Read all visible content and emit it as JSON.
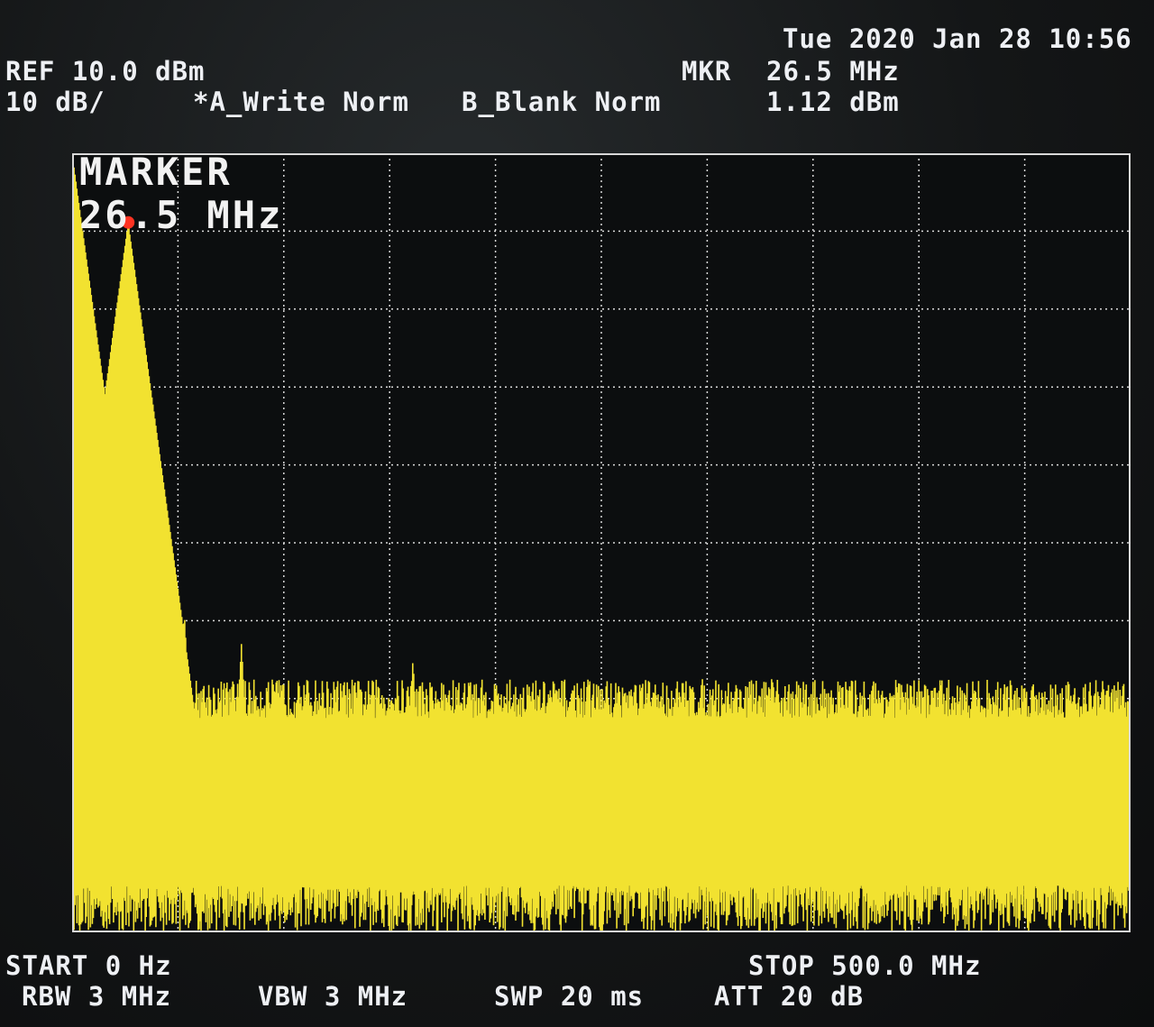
{
  "datetime": "Tue 2020 Jan 28 10:56",
  "ref_label": "REF 10.0 dBm",
  "scale_label": "10 dB/",
  "trace_a": "*A_Write Norm",
  "trace_b": "B_Blank Norm",
  "mkr_label": "MKR",
  "mkr_freq": "26.5 MHz",
  "mkr_level": "1.12 dBm",
  "marker_title": "MARKER",
  "marker_freq": "26.5 MHz",
  "start_label": "START 0 Hz",
  "stop_label": "STOP 500.0 MHz",
  "rbw_label": "RBW 3 MHz",
  "vbw_label": "VBW 3 MHz",
  "swp_label": "SWP 20 ms",
  "att_label": "ATT 20 dB",
  "colors": {
    "trace": "#f2e230",
    "marker": "#ff3322",
    "grid": "#d8d8d8",
    "text": "#eef0f4"
  },
  "chart_data": {
    "type": "line",
    "x_unit": "MHz",
    "y_unit": "dBm",
    "xlim": [
      0,
      500
    ],
    "ylim": [
      -90,
      10
    ],
    "divisions_x": 10,
    "divisions_y": 10,
    "grid": true,
    "marker": {
      "x": 26.5,
      "y": 1.12
    },
    "noise_floor": [
      -60,
      -90
    ],
    "peaks": [
      {
        "x": 0,
        "y": 10
      },
      {
        "x": 26.5,
        "y": 1.12
      },
      {
        "x": 53,
        "y": -49
      },
      {
        "x": 80,
        "y": -53
      },
      {
        "x": 107,
        "y": -57
      },
      {
        "x": 134,
        "y": -59
      },
      {
        "x": 161,
        "y": -55
      },
      {
        "x": 188,
        "y": -57
      },
      {
        "x": 243,
        "y": -59
      },
      {
        "x": 297,
        "y": -59
      }
    ]
  }
}
